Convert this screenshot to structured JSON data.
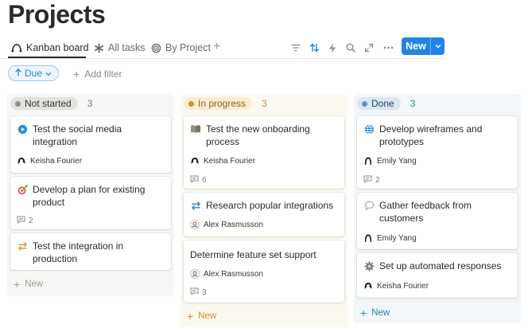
{
  "page": {
    "title": "Projects"
  },
  "views": {
    "tabs": [
      {
        "label": "Kanban board",
        "icon": "kanban-icon"
      },
      {
        "label": "All tasks",
        "icon": "asterisk-icon"
      },
      {
        "label": "By Project",
        "icon": "target-icon"
      }
    ],
    "add_view_icon": "plus-icon"
  },
  "toolbar": {
    "icons": [
      "filter-icon",
      "sort-icon",
      "lightning-icon",
      "search-icon",
      "expand-icon",
      "more-icon"
    ],
    "new_label": "New"
  },
  "filters": {
    "sort_chip_label": "Due",
    "add_filter_label": "Add filter"
  },
  "columns": [
    {
      "status": "Not started",
      "count": "3",
      "colors": {
        "bg": "#f7f7f5",
        "pill": "#e3e2e0",
        "dot": "#91918e",
        "text": "#37352f",
        "count": "#787774"
      },
      "new_label": "New",
      "cards": [
        {
          "icon": "play-circle-icon",
          "title": "Test the social media integration",
          "assignee": "Keisha Fourier"
        },
        {
          "icon": "target-dart-icon",
          "title": "Develop a plan for existing product",
          "comments": "2"
        },
        {
          "icon": "swap-arrows-icon",
          "title": "Test the integration in production"
        }
      ]
    },
    {
      "status": "In progress",
      "count": "3",
      "colors": {
        "bg": "#fcf9f1",
        "pill": "#fbeccf",
        "dot": "#cb912f",
        "text": "#89632a",
        "count": "#cb912f"
      },
      "new_label": "New",
      "cards": [
        {
          "icon": "book-icon",
          "title": "Test the new onboarding process",
          "assignee": "Keisha Fourier",
          "comments": "6"
        },
        {
          "icon": "swap-arrows-icon",
          "title": "Research popular integrations",
          "assignee": "Alex Rasmusson"
        },
        {
          "icon": "",
          "title": "Determine feature set support",
          "assignee": "Alex Rasmusson",
          "comments": "3"
        }
      ]
    },
    {
      "status": "Done",
      "count": "3",
      "colors": {
        "bg": "#f3f7fa",
        "pill": "#d9e7f3",
        "dot": "#5a97c8",
        "text": "#28456c",
        "count": "#337ea9"
      },
      "new_label": "New",
      "cards": [
        {
          "icon": "globe-icon",
          "title": "Develop wireframes and prototypes",
          "assignee": "Emily Yang",
          "comments": "2"
        },
        {
          "icon": "speech-bubble-icon",
          "title": "Gather feedback from customers",
          "assignee": "Emily Yang"
        },
        {
          "icon": "gear-icon",
          "title": "Set up automated responses",
          "assignee": "Keisha Fourier"
        }
      ]
    }
  ]
}
